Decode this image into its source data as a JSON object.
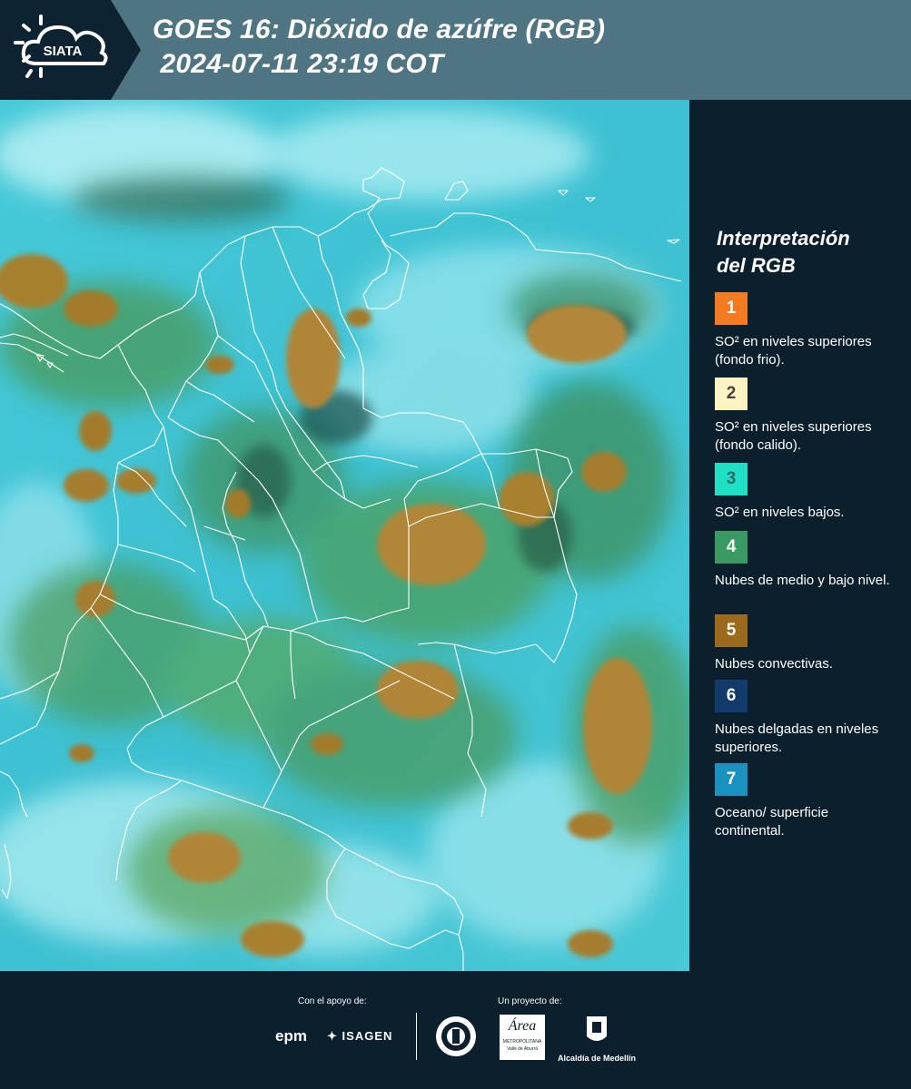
{
  "header": {
    "logo_text": "SIATA",
    "title_line1": "GOES 16: Dióxido de azúfre (RGB)",
    "title_line2": " 2024-07-11 23:19 COT",
    "bg_color": "#4f7482"
  },
  "legend": {
    "title_line1": "Interpretación",
    "title_line2": "del RGB",
    "items": [
      {
        "num": "1",
        "label": "SO² en niveles superiores (fondo frio).",
        "color": "#f47b20",
        "num_color": "#ffffff"
      },
      {
        "num": "2",
        "label": "SO² en niveles superiores (fondo calido).",
        "color": "#fdf3c0",
        "num_color": "#444444"
      },
      {
        "num": "3",
        "label": "SO² en niveles bajos.",
        "color": "#1fe0c4",
        "num_color": "#2c6a6a"
      },
      {
        "num": "4",
        "label": "Nubes de medio y bajo nivel.",
        "color": "#3a9a64",
        "num_color": "#ffffff"
      },
      {
        "num": "5",
        "label": "Nubes convectivas.",
        "color": "#9b6a1a",
        "num_color": "#ffffff"
      },
      {
        "num": "6",
        "label": "Nubes delgadas en niveles superiores.",
        "color": "#123a6a",
        "num_color": "#ffffff"
      },
      {
        "num": "7",
        "label": "Oceano/ superficie continental.",
        "color": "#1a92c0",
        "num_color": "#ffffff"
      }
    ]
  },
  "footer": {
    "support_label": "Con el apoyo de:",
    "project_label": "Un proyecto de:",
    "epm": "epm",
    "isagen": "ISAGEN",
    "area_main": "Área",
    "area_sub1": "METROPOLITANA",
    "area_sub2": "Valle de Aburrá",
    "alcaldia": "Alcaldía de Medellín"
  }
}
